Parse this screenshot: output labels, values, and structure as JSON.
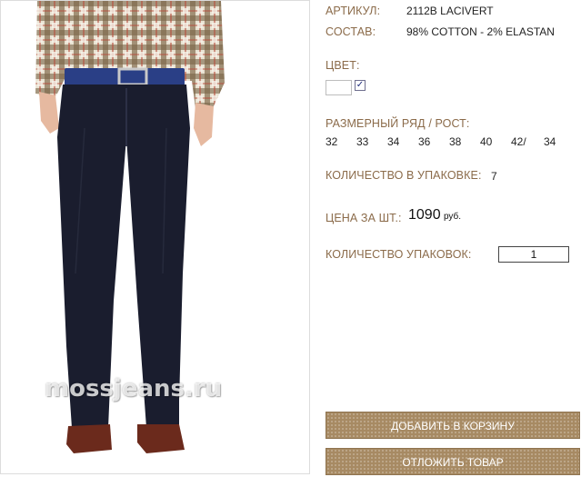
{
  "product": {
    "article_label": "АРТИКУЛ:",
    "article_value": "2112B LACIVERT",
    "composition_label": "СОСТАВ:",
    "composition_value": "98% COTTON - 2% ELASTAN",
    "color_label": "ЦВЕТ:",
    "color_swatch": "#ffffff",
    "color_checked": "✓",
    "size_label": "РАЗМЕРНЫЙ РЯД / РОСТ:",
    "sizes": [
      "32",
      "33",
      "34",
      "36",
      "38",
      "40",
      "42/",
      "34"
    ],
    "pack_qty_label": "КОЛИЧЕСТВО В УПАКОВКЕ:",
    "pack_qty_value": "7",
    "price_label": "ЦЕНА ЗА ШТ.:",
    "price_value": "1090",
    "price_currency": "руб.",
    "packs_label": "КОЛИЧЕСТВО УПАКОВОК:",
    "packs_value": "1"
  },
  "buttons": {
    "add_to_cart": "ДОБАВИТЬ В КОРЗИНУ",
    "postpone": "ОТЛОЖИТЬ ТОВАР"
  },
  "photo": {
    "watermark": "mossjeans.ru",
    "pants_color": "#1a1d2e",
    "belt_color": "#2a3f86"
  },
  "colors": {
    "label": "#8b6b4a",
    "button": "#a78a63"
  }
}
